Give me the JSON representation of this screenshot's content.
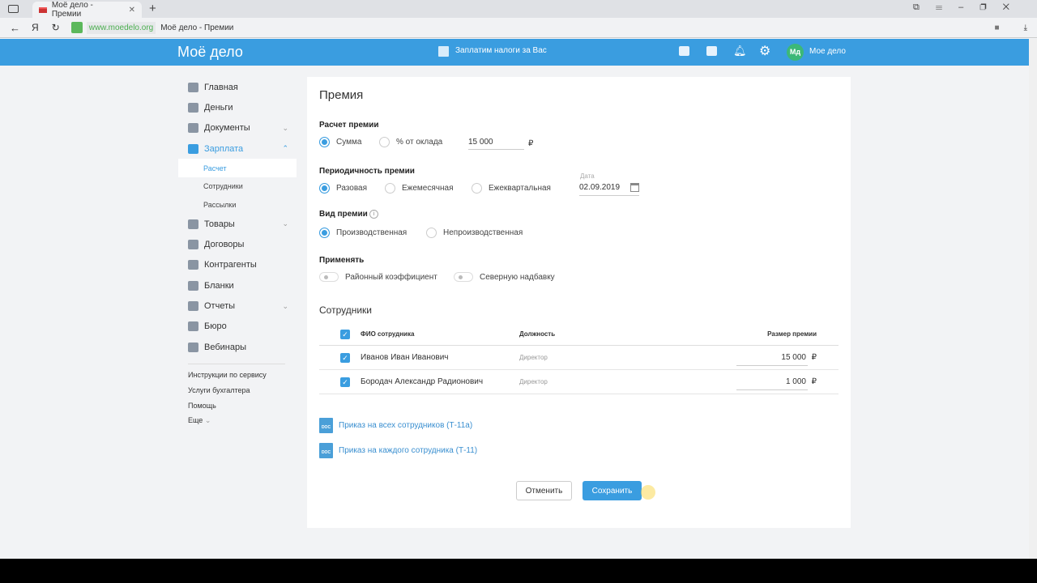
{
  "browser": {
    "tab_title": "Моё дело - Премии",
    "domain": "www.moedelo.org",
    "page_title": "Моё дело - Премии"
  },
  "header": {
    "logo": "Моё дело",
    "promo": "Заплатим налоги за Вас",
    "avatar": "Мд",
    "user": "Мое дело"
  },
  "sidebar": {
    "items": [
      {
        "label": "Главная"
      },
      {
        "label": "Деньги"
      },
      {
        "label": "Документы",
        "chevron": "down"
      },
      {
        "label": "Зарплата",
        "chevron": "up",
        "active": true
      }
    ],
    "sub": [
      "Расчет",
      "Сотрудники",
      "Рассылки"
    ],
    "items2": [
      {
        "label": "Товары",
        "chevron": "down"
      },
      {
        "label": "Договоры"
      },
      {
        "label": "Контрагенты"
      },
      {
        "label": "Бланки"
      },
      {
        "label": "Отчеты",
        "chevron": "down"
      },
      {
        "label": "Бюро"
      },
      {
        "label": "Вебинары"
      }
    ],
    "footer": [
      "Инструкции по сервису",
      "Услуги бухгалтера",
      "Помощь",
      "Еще"
    ]
  },
  "form": {
    "title": "Премия",
    "calc_label": "Расчет премии",
    "calc_options": [
      "Сумма",
      "% от оклада"
    ],
    "amount": "15 000",
    "currency": "₽",
    "period_label": "Периодичность премии",
    "period_options": [
      "Разовая",
      "Ежемесячная",
      "Ежеквартальная"
    ],
    "date_label": "Дата",
    "date": "02.09.2019",
    "type_label": "Вид премии",
    "type_options": [
      "Производственная",
      "Непроизводственная"
    ],
    "apply_label": "Применять",
    "apply_options": [
      "Районный коэффициент",
      "Северную надбавку"
    ],
    "employees_title": "Сотрудники",
    "columns": [
      "ФИО сотрудника",
      "Должность",
      "Размер премии"
    ],
    "rows": [
      {
        "name": "Иванов Иван Иванович",
        "position": "Директор",
        "amount": "15 000"
      },
      {
        "name": "Бородач Александр Радионович",
        "position": "Директор",
        "amount": "1 000"
      }
    ],
    "links": [
      "Приказ на всех сотрудников (Т-11а)",
      "Приказ на каждого сотрудника (Т-11)"
    ],
    "doc_icon": "DOC",
    "cancel": "Отменить",
    "save": "Сохранить"
  }
}
